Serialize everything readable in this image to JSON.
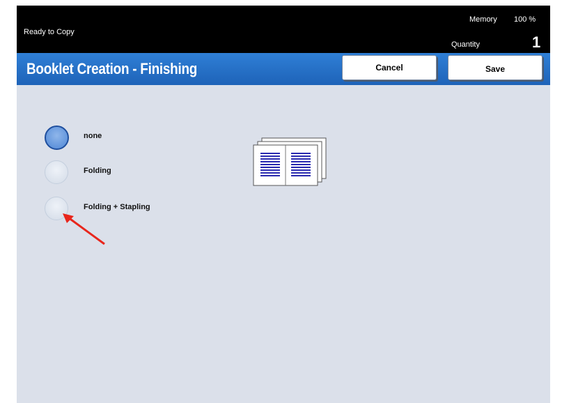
{
  "status": {
    "left_text": "Ready to Copy",
    "memory_label": "Memory",
    "memory_value": "100 %",
    "quantity_label": "Quantity",
    "quantity_value": "1"
  },
  "header": {
    "title": "Booklet Creation - Finishing",
    "cancel_label": "Cancel",
    "save_label": "Save"
  },
  "options": [
    {
      "label": "none",
      "selected": true
    },
    {
      "label": "Folding",
      "selected": false
    },
    {
      "label": "Folding + Stapling",
      "selected": false
    }
  ],
  "colors": {
    "title_bar": "#1e63b8",
    "content_bg": "#dbe0ea",
    "annotation_arrow": "#e8261c",
    "booklet_lines": "#2a2ab0"
  },
  "icons": {
    "preview": "booklet-icon",
    "annotation": "red-arrow"
  }
}
